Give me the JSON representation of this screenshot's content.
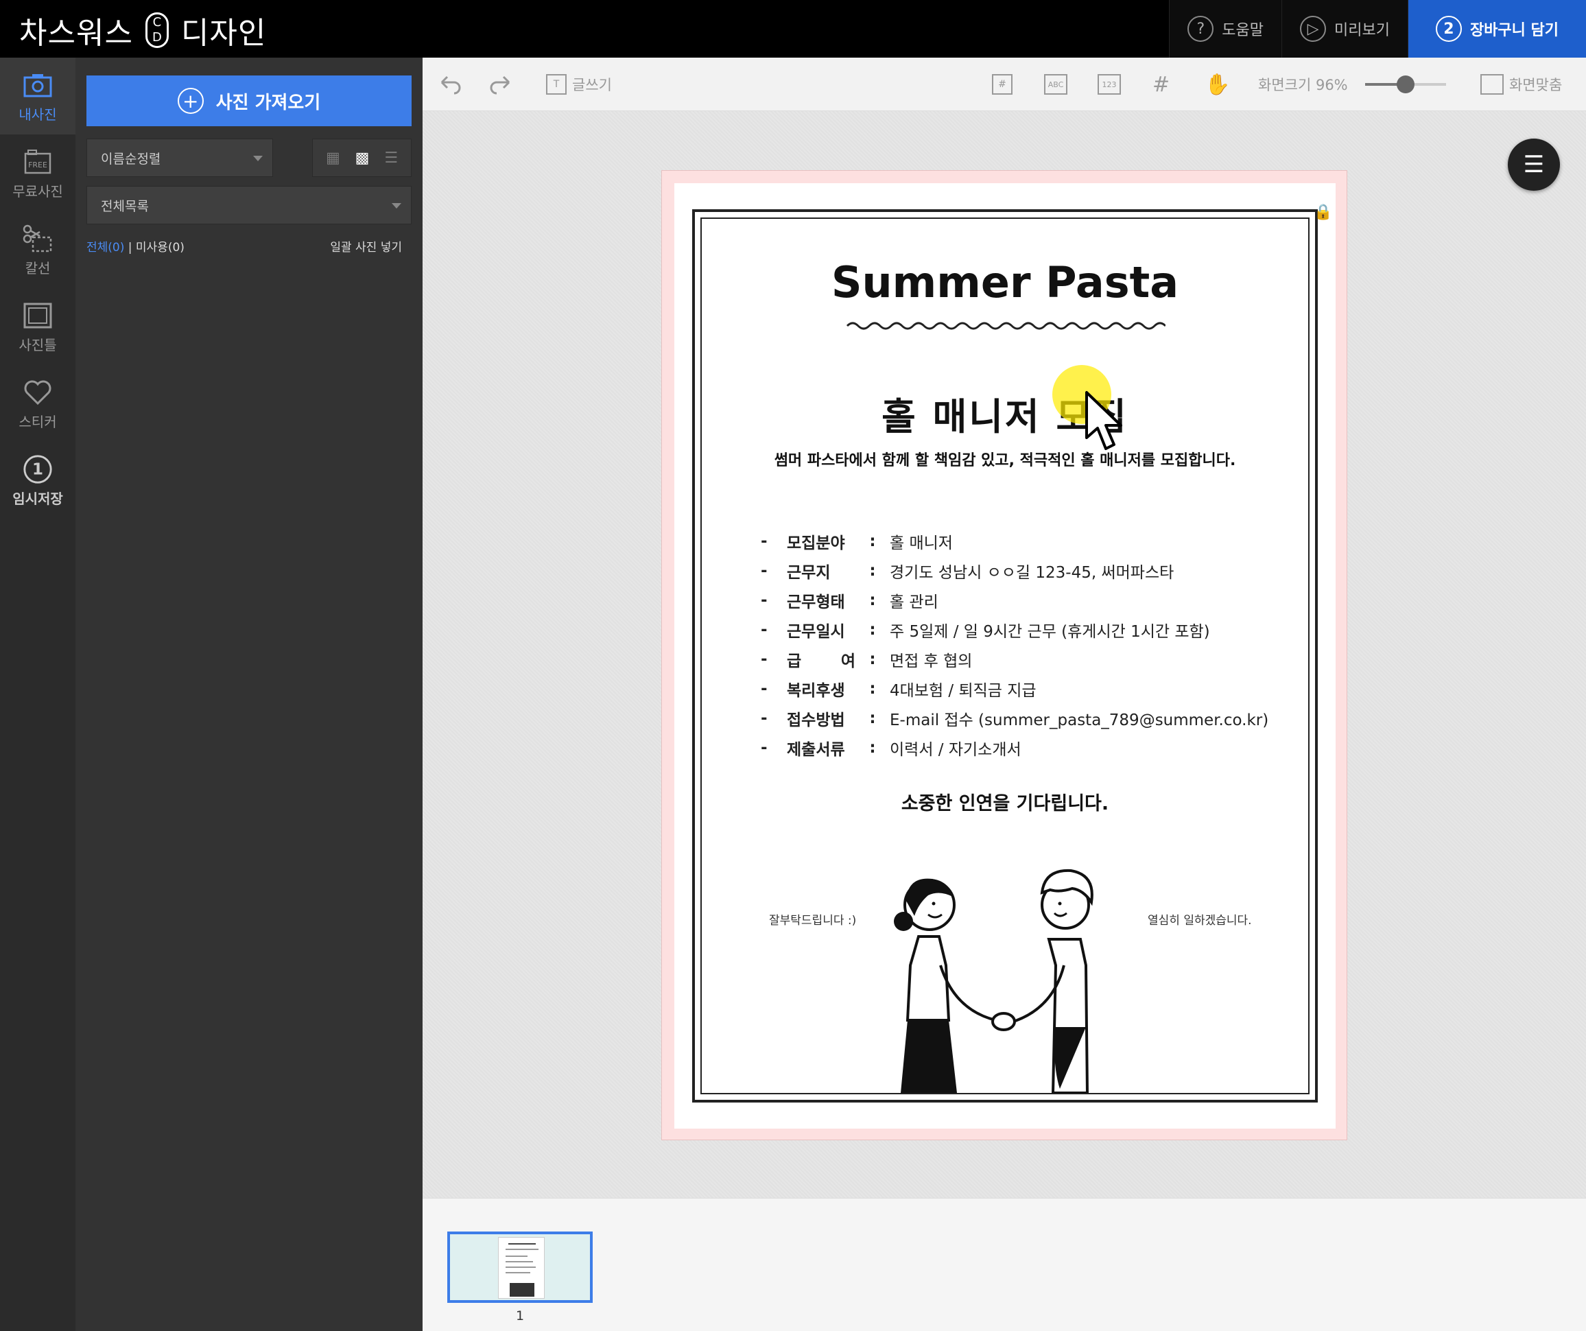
{
  "app": {
    "brand": "차스워스",
    "badge_top": "C",
    "badge_bottom": "D",
    "design": "디자인"
  },
  "top_actions": {
    "help": "도움말",
    "preview": "미리보기",
    "cart_number": "2",
    "cart": "장바구니 담기"
  },
  "rail": [
    {
      "label": "내사진",
      "icon": "camera-icon"
    },
    {
      "label": "무료사진",
      "icon": "free-photo-icon"
    },
    {
      "label": "칼선",
      "icon": "scissors-icon"
    },
    {
      "label": "사진틀",
      "icon": "frame-icon"
    },
    {
      "label": "스티커",
      "icon": "heart-icon"
    },
    {
      "label": "임시저장",
      "icon": "save-count-icon",
      "badge": "1"
    }
  ],
  "panel": {
    "import_label": "사진 가져오기",
    "sort_value": "이름순정렬",
    "list_value": "전체목록",
    "all_filter": "전체(0)",
    "separator": "|",
    "unused_filter": "미사용(0)",
    "bulk_insert": "일괄 사진 넣기"
  },
  "toolbar": {
    "text_tool": "글쓰기",
    "zoom_label": "화면크기 96%",
    "zoom_fraction": 0.5,
    "fit_screen": "화면맞춤"
  },
  "document": {
    "title": "Summer Pasta",
    "heading": "홀 매니저 모집",
    "subheading": "썸머 파스타에서 함께 할 책임감 있고, 적극적인 홀 매니저를 모집합니다.",
    "rows": [
      {
        "label": "모집분야",
        "value": "홀 매니저"
      },
      {
        "label": "근무지",
        "value": "경기도 성남시 ㅇㅇ길 123-45, 써머파스타"
      },
      {
        "label": "근무형태",
        "value": "홀 관리"
      },
      {
        "label": "근무일시",
        "value": "주 5일제 / 일 9시간 근무 (휴게시간 1시간 포함)"
      },
      {
        "label": "급 여",
        "value": "면접 후 협의"
      },
      {
        "label": "복리후생",
        "value": "4대보험 / 퇴직금 지급"
      },
      {
        "label": "접수방법",
        "value": "E-mail 접수 (summer_pasta_789@summer.co.kr)"
      },
      {
        "label": "제출서류",
        "value": "이력서 / 자기소개서"
      }
    ],
    "closing": "소중한 인연을 기다립니다.",
    "caption_left": "잘부탁드립니다 :)",
    "caption_right": "열심히 일하겠습니다."
  },
  "pages": [
    {
      "number": "1"
    }
  ],
  "colors": {
    "accent": "#3d7de8",
    "topbar": "#000000",
    "page_bleed": "#fde0e0"
  }
}
